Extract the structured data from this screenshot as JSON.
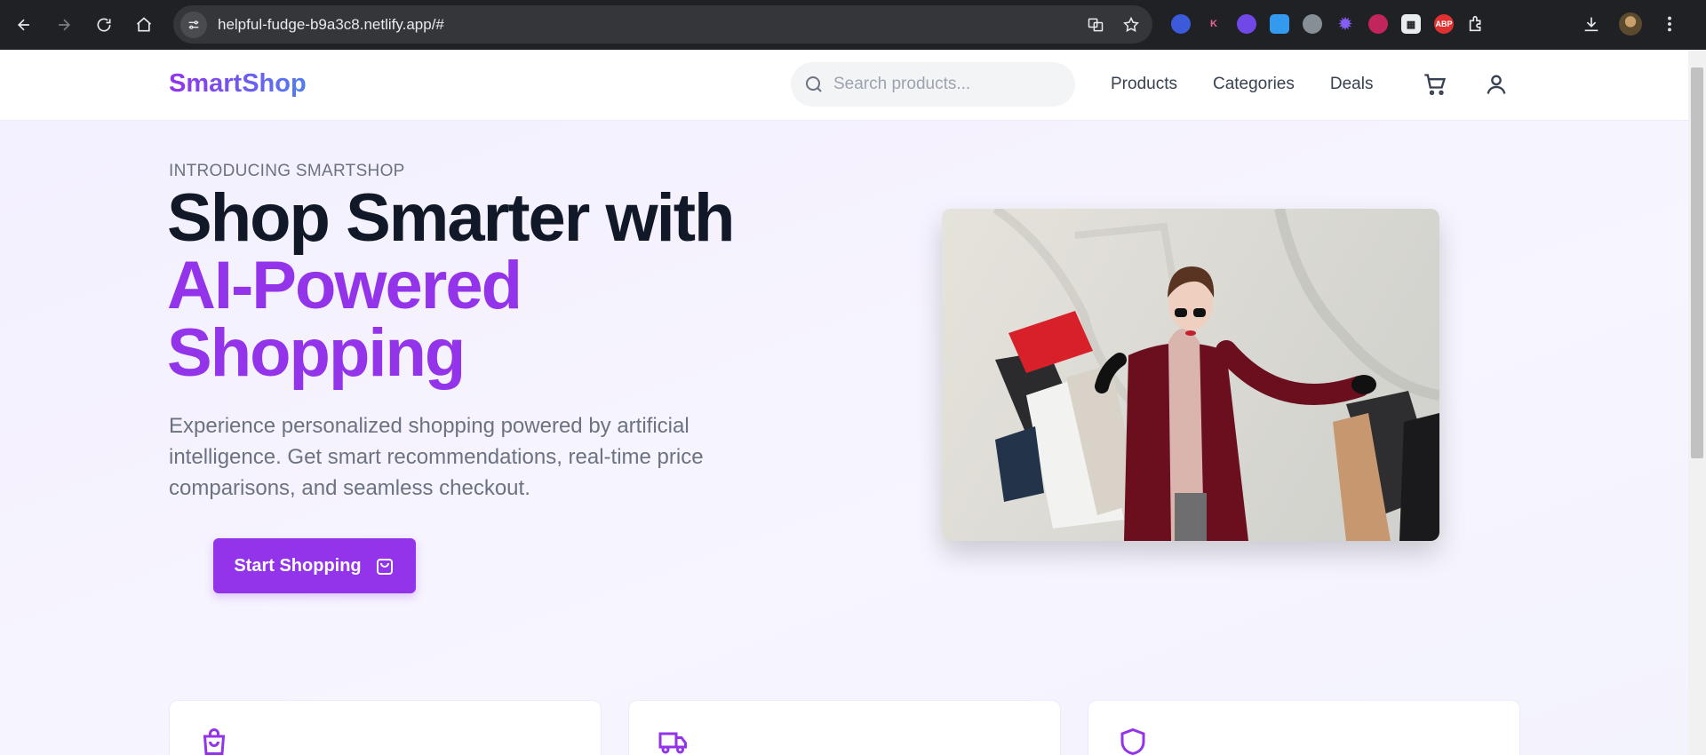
{
  "browser": {
    "url": "helpful-fudge-b9a3c8.netlify.app/#",
    "extensions": [
      {
        "name": "ext-blue-icon",
        "label": "",
        "color": "#3b5bdb"
      },
      {
        "name": "ext-k-icon",
        "label": "K",
        "color": "#202124"
      },
      {
        "name": "ext-purple-icon",
        "label": "",
        "color": "#7048e8"
      },
      {
        "name": "ext-drop-icon",
        "label": "",
        "color": "#339af0"
      },
      {
        "name": "ext-globe-icon",
        "label": "",
        "color": "#868e96"
      },
      {
        "name": "ext-star-icon",
        "label": "",
        "color": "#5f3dc4"
      },
      {
        "name": "ext-brain-icon",
        "label": "",
        "color": "#c2255c"
      },
      {
        "name": "ext-qr-icon",
        "label": "",
        "color": "#e9ecef"
      },
      {
        "name": "ext-abp-icon",
        "label": "ABP",
        "color": "#e03131"
      }
    ]
  },
  "header": {
    "logo": "SmartShop",
    "search_placeholder": "Search products...",
    "nav": [
      "Products",
      "Categories",
      "Deals"
    ]
  },
  "hero": {
    "eyebrow": "INTRODUCING SMARTSHOP",
    "headline_1": "Shop Smarter with",
    "headline_2": "AI-Powered",
    "headline_3": "Shopping",
    "subtext": "Experience personalized shopping powered by artificial intelligence. Get smart recommendations, real-time price comparisons, and seamless checkout.",
    "cta": "Start Shopping"
  },
  "features": [
    {
      "icon": "shopping-bag-icon"
    },
    {
      "icon": "truck-icon"
    },
    {
      "icon": "shield-icon"
    }
  ],
  "colors": {
    "accent": "#9333ea",
    "text": "#111827",
    "muted": "#6b7280"
  }
}
